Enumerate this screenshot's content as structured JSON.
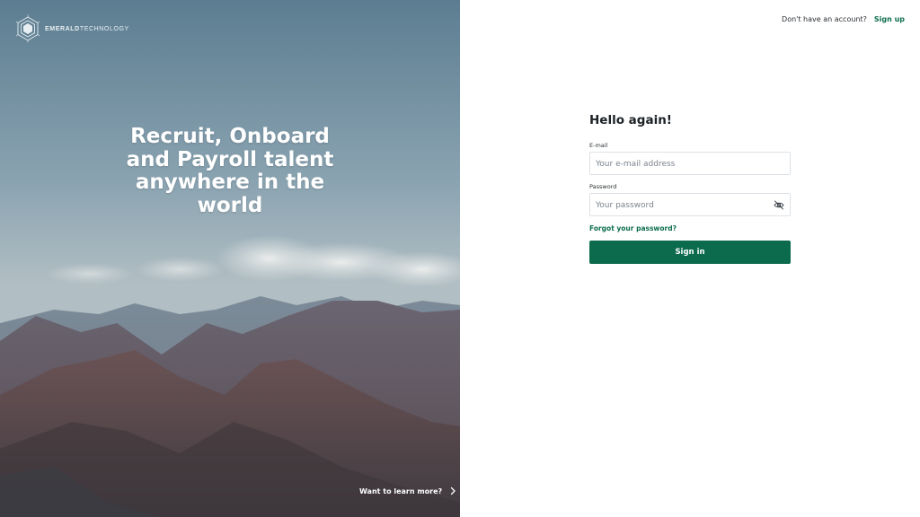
{
  "brand": {
    "logo_icon": "hexagon-logo-icon",
    "name_strong": "EMERALD",
    "name_light": "TECHNOLOGY"
  },
  "hero": {
    "headline": "Recruit, Onboard and Payroll talent anywhere in the world",
    "learn_more_label": "Want to learn more?",
    "learn_more_icon": "chevron-right-icon"
  },
  "topbar": {
    "prompt": "Don't have an account?",
    "signup_label": "Sign up"
  },
  "form": {
    "title": "Hello again!",
    "email_label": "E-mail",
    "email_placeholder": "Your e-mail address",
    "email_value": "",
    "password_label": "Password",
    "password_placeholder": "Your password",
    "password_value": "",
    "password_toggle_icon": "eye-off-icon",
    "forgot_label": "Forgot your password?",
    "submit_label": "Sign in"
  },
  "colors": {
    "accent": "#0d6b4d",
    "link": "#0e6e4e"
  }
}
